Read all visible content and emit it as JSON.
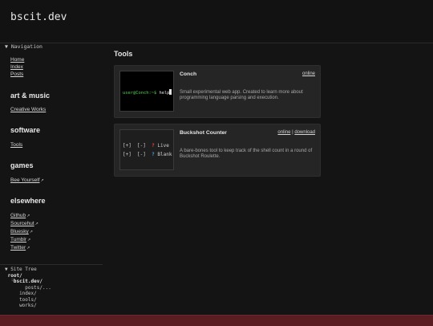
{
  "header": {
    "site_title": "bscit.dev"
  },
  "sidebar": {
    "nav_header": "▼ Navigation",
    "nav_links": [
      "Home",
      "Index",
      "Posts"
    ],
    "sections": [
      {
        "title": "art & music",
        "links": [
          "Creative Works"
        ],
        "external": [
          false
        ]
      },
      {
        "title": "software",
        "links": [
          "Tools"
        ],
        "external": [
          false
        ]
      },
      {
        "title": "games",
        "links": [
          "Bee Yourself"
        ],
        "external": [
          true
        ]
      },
      {
        "title": "elsewhere",
        "links": [
          "Github",
          "Sourcehut",
          "Bluesky",
          "Tumblr",
          "Twitter"
        ],
        "external": [
          true,
          true,
          true,
          true,
          true
        ]
      }
    ],
    "tree": {
      "header": "▼ Site Tree",
      "root": "root/",
      "site": "bscit.dev/",
      "children": [
        "posts/...",
        "index/",
        "tools/",
        "works/"
      ]
    }
  },
  "main": {
    "title": "Tools",
    "cards": [
      {
        "name": "Conch",
        "links": [
          "online"
        ],
        "description": "Small experimental web app. Created to learn more about programming language parsing and execution.",
        "thumb": {
          "prompt_user": "user@Conch:~$",
          "prompt_cmd": " help"
        }
      },
      {
        "name": "Buckshot Counter",
        "links": [
          "online",
          "download"
        ],
        "separator": "|",
        "description": "A bare-bones tool to keep track of the shell count in a round of Buckshot Roulette.",
        "thumb": {
          "row1_buttons": "[+]  [-]",
          "row1_mark": "?",
          "row1_label": "Live",
          "row2_buttons": "[+]  [-]",
          "row2_mark": "?",
          "row2_label": "Blank"
        }
      }
    ]
  },
  "colors": {
    "background": "#141414",
    "card": "#252525",
    "footer": "#5a1e22",
    "prompt_green": "#4fd04f",
    "live_red": "#e04545",
    "blank_blue": "#4aa0e0"
  }
}
